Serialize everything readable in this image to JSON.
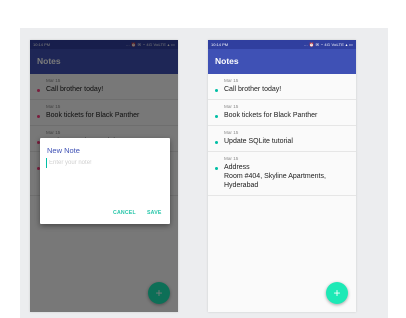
{
  "colors": {
    "primary": "#3f51b5",
    "primary_dark": "#303f9f",
    "accent": "#1de9b6",
    "bullet_accent": "#00bfa5",
    "bullet_pink": "#ff4081"
  },
  "status_bar": {
    "time": "10:14 PM",
    "icons_text": "... ⏰ ✉ ◔ 4G VoLTE ▴ ▭"
  },
  "app": {
    "title": "Notes"
  },
  "notes": [
    {
      "date": "Mar 15",
      "text": "Call brother today!"
    },
    {
      "date": "Mar 15",
      "text": "Book tickets for Black Panther"
    },
    {
      "date": "Mar 15",
      "text": "Update SQLite tutorial"
    },
    {
      "date": "Mar 15",
      "text": "Address\nRoom #404, Skyline Apartments,\nHyderabad"
    }
  ],
  "dialog": {
    "title": "New Note",
    "input_placeholder": "Enter your note!",
    "input_value": "",
    "cancel_label": "CANCEL",
    "save_label": "SAVE"
  },
  "fab": {
    "icon": "plus-icon",
    "glyph": "+"
  }
}
